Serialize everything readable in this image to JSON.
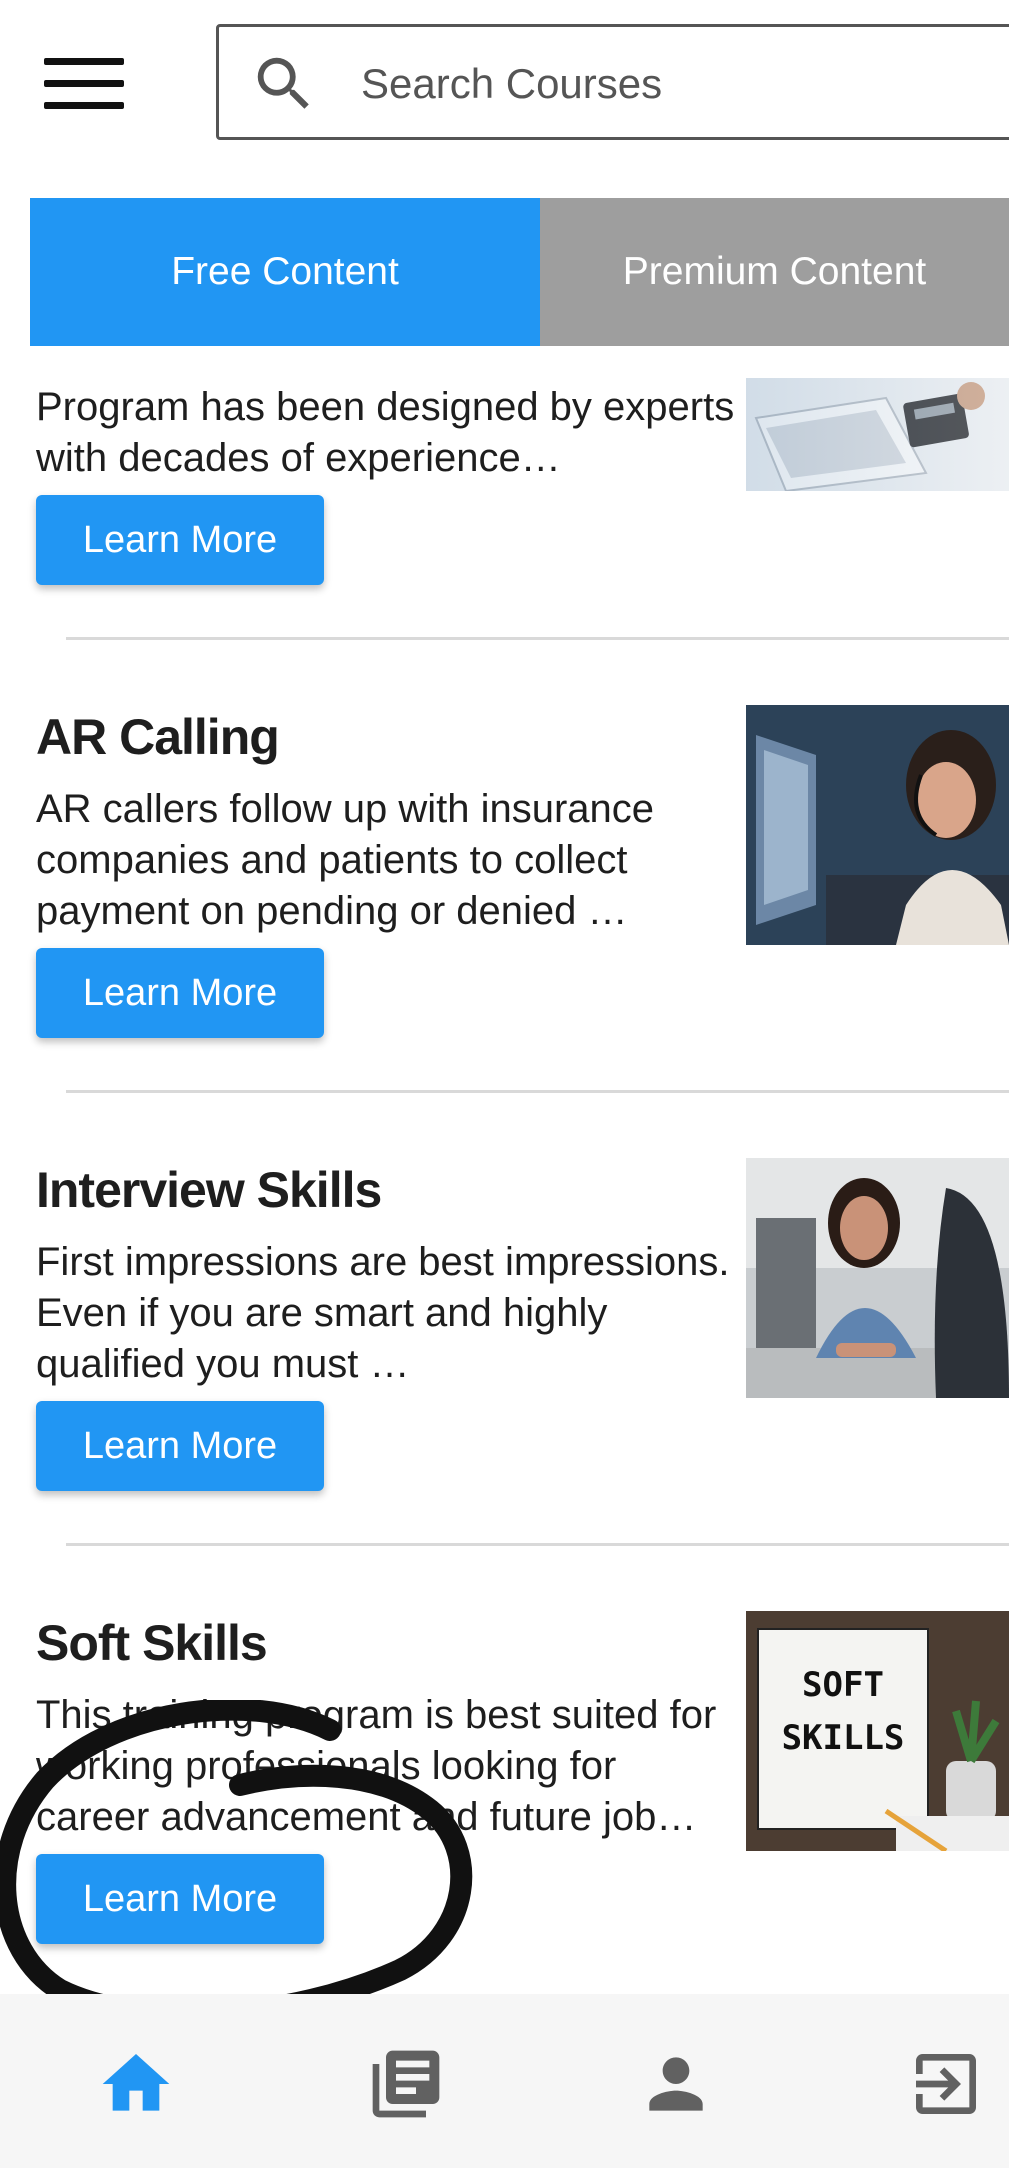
{
  "search": {
    "placeholder": "Search Courses"
  },
  "tabs": [
    {
      "label": "Free Content",
      "active": true
    },
    {
      "label": "Premium Content",
      "active": false
    }
  ],
  "courses": [
    {
      "title": "",
      "description": "Program has been designed by experts with decades of experience…",
      "button_label": "Learn More",
      "image": "laptop-and-calculator-photo"
    },
    {
      "title": "AR Calling",
      "description": "AR callers follow up with insurance companies and patients to collect payment on pending or denied …",
      "button_label": "Learn More",
      "image": "call-center-agent-photo"
    },
    {
      "title": "Interview Skills",
      "description": "First impressions are best impressions. Even if you are smart and highly qualified you must …",
      "button_label": "Learn More",
      "image": "interview-candidate-photo"
    },
    {
      "title": "Soft Skills",
      "description": "This training program is best suited for working professionals looking for career advancement and future job…",
      "button_label": "Learn More",
      "image": "soft-skills-lightbox-photo",
      "image_text": [
        "SOFT",
        "SKILLS"
      ]
    }
  ],
  "bottom_nav": [
    {
      "icon": "home-icon",
      "active": true
    },
    {
      "icon": "library-icon",
      "active": false
    },
    {
      "icon": "profile-icon",
      "active": false
    },
    {
      "icon": "logout-icon",
      "active": false
    }
  ],
  "colors": {
    "accent": "#2196f3",
    "inactive_tab": "#9e9e9e",
    "nav_inactive": "#616161"
  }
}
